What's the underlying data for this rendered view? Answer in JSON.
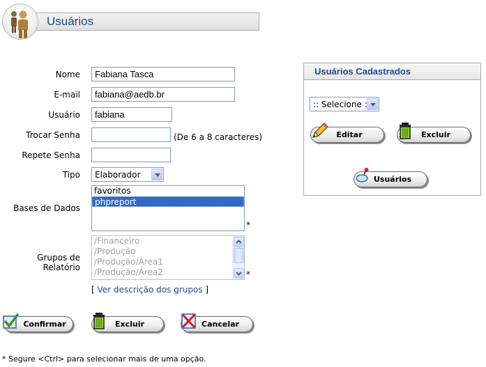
{
  "header": {
    "title": "Usuários"
  },
  "form": {
    "nome": {
      "label": "Nome",
      "value": "Fabiana Tasca"
    },
    "email": {
      "label": "E-mail",
      "value": "fabiana@aedb.br"
    },
    "usuario": {
      "label": "Usuário",
      "value": "fabiana"
    },
    "trocar_senha": {
      "label": "Trocar Senha",
      "value": "",
      "hint": "(De 6 a 8 caracteres)"
    },
    "repete_senha": {
      "label": "Repete Senha",
      "value": ""
    },
    "tipo": {
      "label": "Tipo",
      "selected": "Elaborador"
    },
    "bases": {
      "label": "Bases de Dados",
      "options": [
        "favoritos",
        "phpreport"
      ],
      "selected": "phpreport",
      "required_mark": "*"
    },
    "grupos": {
      "label": "Grupos de Relatório",
      "options": [
        "/Financeiro",
        "/Produção",
        "/Produção/Área1",
        "/Produção/Área2"
      ],
      "required_mark": "*"
    },
    "link": {
      "open": "[",
      "text": "Ver descrição dos grupos",
      "close": "]"
    }
  },
  "buttons": {
    "confirmar": "Confirmar",
    "excluir": "Excluir",
    "cancelar": "Cancelar"
  },
  "panel": {
    "title": "Usuários Cadastrados",
    "select": ":: Selecione ::",
    "editar": "Editar",
    "excluir": "Excluir",
    "usuarios": "Usuários"
  },
  "footer": "* Segure <Ctrl> para selecionar mais de uma opção."
}
